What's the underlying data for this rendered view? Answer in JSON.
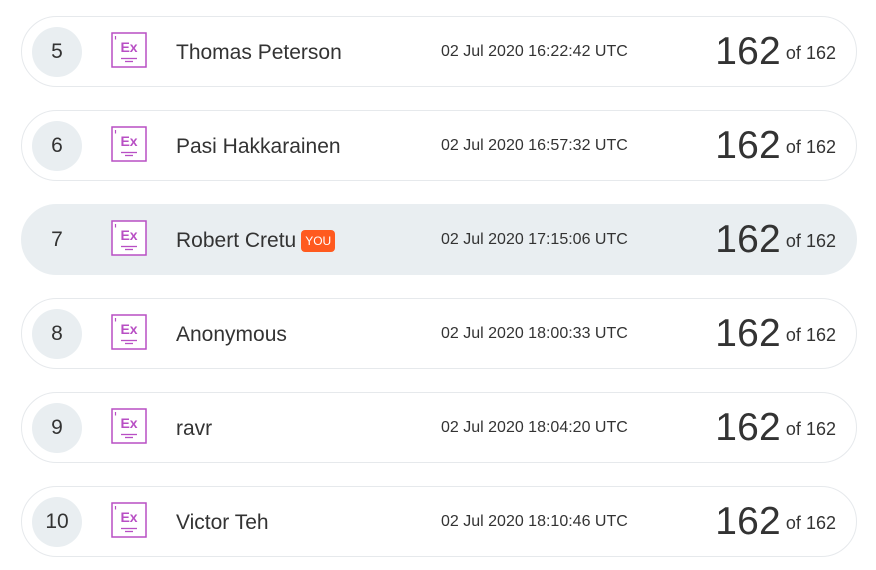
{
  "leaderboard": {
    "rows": [
      {
        "rank": "5",
        "badge_icon": "ex-badge-icon",
        "badge_text": "Ex",
        "name": "Thomas Peterson",
        "you_label": "",
        "timestamp": "02 Jul 2020 16:22:42 UTC",
        "score": "162",
        "of_label": "of",
        "total": "162",
        "highlighted": false
      },
      {
        "rank": "6",
        "badge_icon": "ex-badge-icon",
        "badge_text": "Ex",
        "name": "Pasi Hakkarainen",
        "you_label": "",
        "timestamp": "02 Jul 2020 16:57:32 UTC",
        "score": "162",
        "of_label": "of",
        "total": "162",
        "highlighted": false
      },
      {
        "rank": "7",
        "badge_icon": "ex-badge-icon",
        "badge_text": "Ex",
        "name": "Robert Cretu",
        "you_label": "YOU",
        "timestamp": "02 Jul 2020 17:15:06 UTC",
        "score": "162",
        "of_label": "of",
        "total": "162",
        "highlighted": true
      },
      {
        "rank": "8",
        "badge_icon": "ex-badge-icon",
        "badge_text": "Ex",
        "name": "Anonymous",
        "you_label": "",
        "timestamp": "02 Jul 2020 18:00:33 UTC",
        "score": "162",
        "of_label": "of",
        "total": "162",
        "highlighted": false
      },
      {
        "rank": "9",
        "badge_icon": "ex-badge-icon",
        "badge_text": "Ex",
        "name": "ravr",
        "you_label": "",
        "timestamp": "02 Jul 2020 18:04:20 UTC",
        "score": "162",
        "of_label": "of",
        "total": "162",
        "highlighted": false
      },
      {
        "rank": "10",
        "badge_icon": "ex-badge-icon",
        "badge_text": "Ex",
        "name": "Victor Teh",
        "you_label": "",
        "timestamp": "02 Jul 2020 18:10:46 UTC",
        "score": "162",
        "of_label": "of",
        "total": "162",
        "highlighted": false
      }
    ]
  },
  "colors": {
    "badge_purple": "#b84fc4",
    "you_tag": "#ff5a1f",
    "rank_circle": "#e9eef1",
    "highlight_row": "#e9eef1",
    "row_border": "#e6e9ec",
    "text": "#333333"
  }
}
